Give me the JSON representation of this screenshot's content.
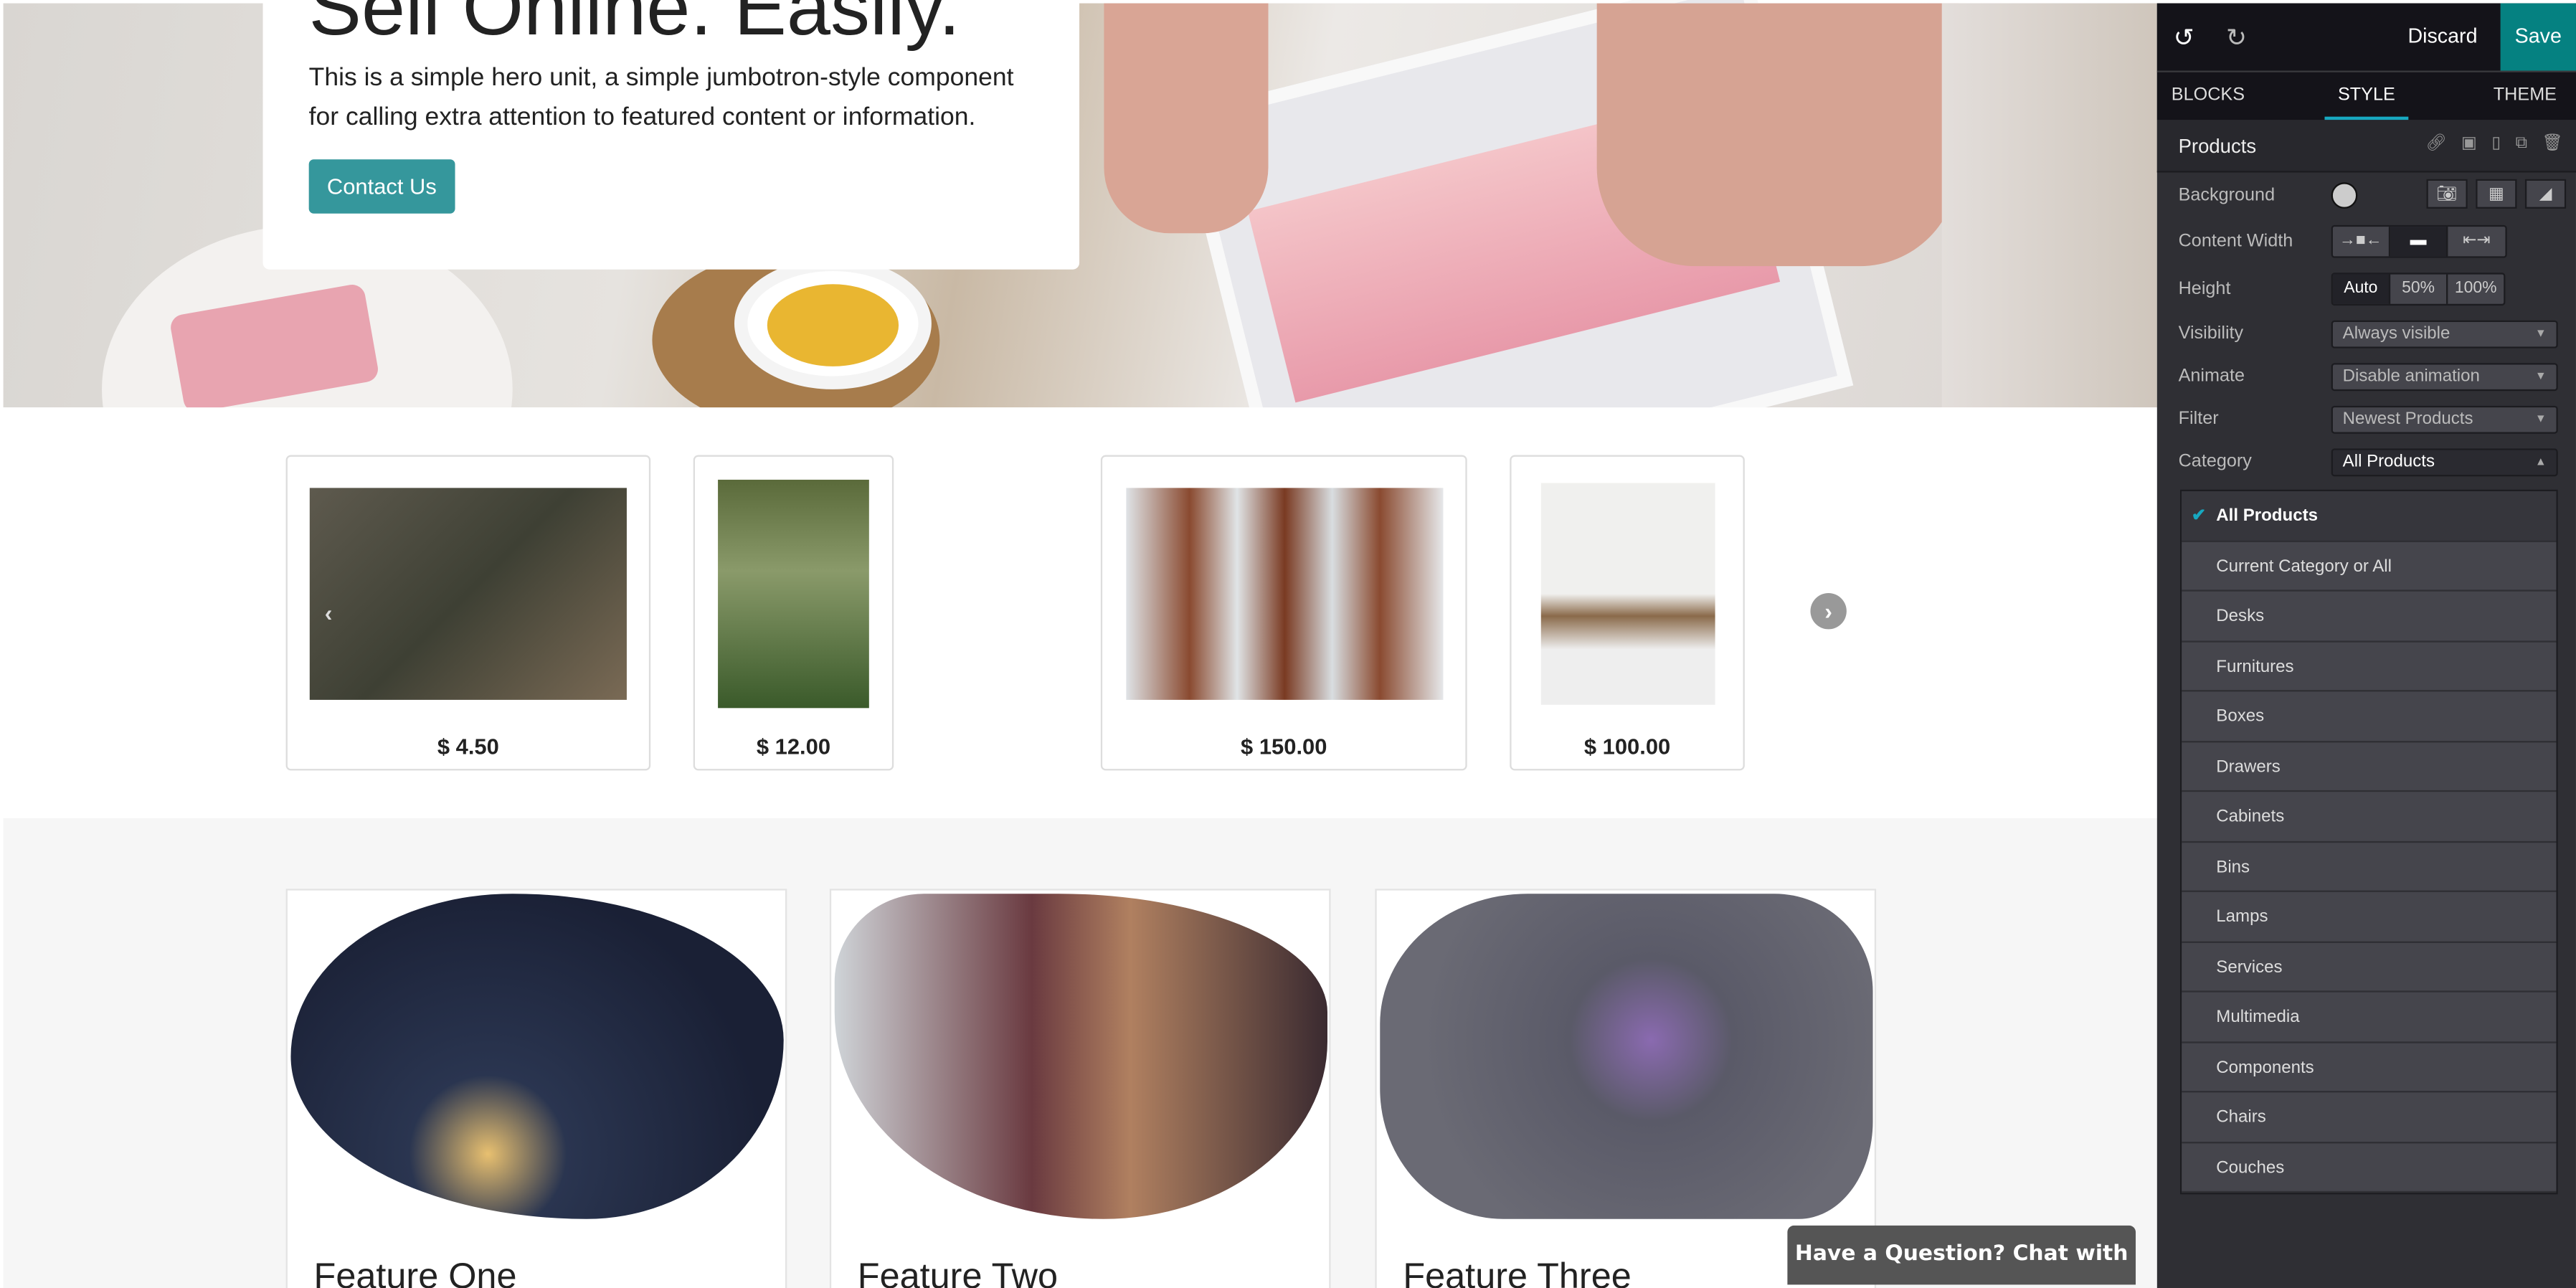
{
  "hero": {
    "title": "Sell Online. Easily.",
    "description": "This is a simple hero unit, a simple jumbotron-style component for calling extra attention to featured content or information.",
    "button": "Contact Us"
  },
  "products": [
    {
      "price": "$ 4.50"
    },
    {
      "price": "$ 12.00"
    },
    {
      "price": "$ 150.00"
    },
    {
      "price": "$ 100.00"
    }
  ],
  "features": [
    {
      "title": "Feature One"
    },
    {
      "title": "Feature Two"
    },
    {
      "title": "Feature Three"
    }
  ],
  "chat": {
    "label": "Have a Question? Chat with us."
  },
  "editor": {
    "discard": "Discard",
    "save": "Save",
    "tabs": [
      "BLOCKS",
      "STYLE",
      "THEME"
    ],
    "active_tab": "STYLE",
    "section": "Products",
    "labels": {
      "background": "Background",
      "content_width": "Content Width",
      "height": "Height",
      "visibility": "Visibility",
      "animate": "Animate",
      "filter": "Filter",
      "category": "Category"
    },
    "height_options": [
      "Auto",
      "50%",
      "100%"
    ],
    "height_selected": "Auto",
    "visibility": "Always visible",
    "animate": "Disable animation",
    "filter": "Newest Products",
    "category": "All Products",
    "category_options": [
      "All Products",
      "Current Category or All",
      "Desks",
      "Furnitures",
      "Boxes",
      "Drawers",
      "Cabinets",
      "Bins",
      "Lamps",
      "Services",
      "Multimedia",
      "Components",
      "Chairs",
      "Couches"
    ],
    "accent": "#058181",
    "highlight": "#17a8c0"
  }
}
